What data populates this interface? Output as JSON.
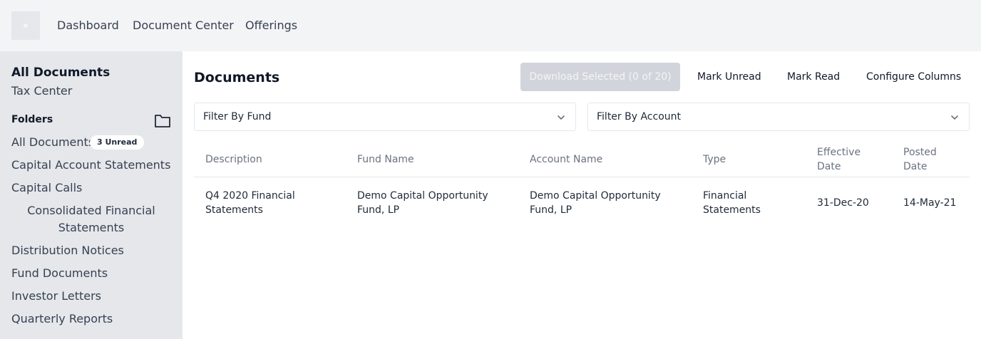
{
  "nav": {
    "links": [
      "Dashboard",
      "Document Center",
      "Offerings"
    ]
  },
  "sidebar": {
    "title": "All Documents",
    "tax_center": "Tax Center",
    "folders_heading": "Folders",
    "items": [
      {
        "label": "All Documents",
        "badge": "3 Unread"
      },
      {
        "label": "Capital Account Statements"
      },
      {
        "label": "Capital Calls"
      },
      {
        "label": "Consolidated Financial Statements"
      },
      {
        "label": "Distribution Notices"
      },
      {
        "label": "Fund Documents"
      },
      {
        "label": "Investor Letters"
      },
      {
        "label": "Quarterly Reports"
      }
    ]
  },
  "main": {
    "title": "Documents",
    "download_label": "Download Selected (0 of 20)",
    "mark_unread_label": "Mark Unread",
    "mark_read_label": "Mark Read",
    "configure_label": "Configure Columns",
    "filter_fund": "Filter By Fund",
    "filter_account": "Filter By Account",
    "columns": [
      "Description",
      "Fund Name",
      "Account Name",
      "Type",
      "Effective Date",
      "Posted Date"
    ],
    "rows": [
      {
        "description": "Q4 2020 Financial Statements",
        "fund_name": "Demo Capital Opportunity Fund, LP",
        "account_name": "Demo Capital Opportunity Fund, LP",
        "type": "Financial Statements",
        "effective_date": "31-Dec-20",
        "posted_date": "14-May-21"
      }
    ]
  },
  "icons": {
    "folder": "folder-icon",
    "chevron": "chevron-down-icon"
  },
  "colors": {
    "topbar_bg": "#f3f4f6",
    "sidebar_bg": "#e5e7eb",
    "disabled_button_bg": "#d1d5db"
  }
}
